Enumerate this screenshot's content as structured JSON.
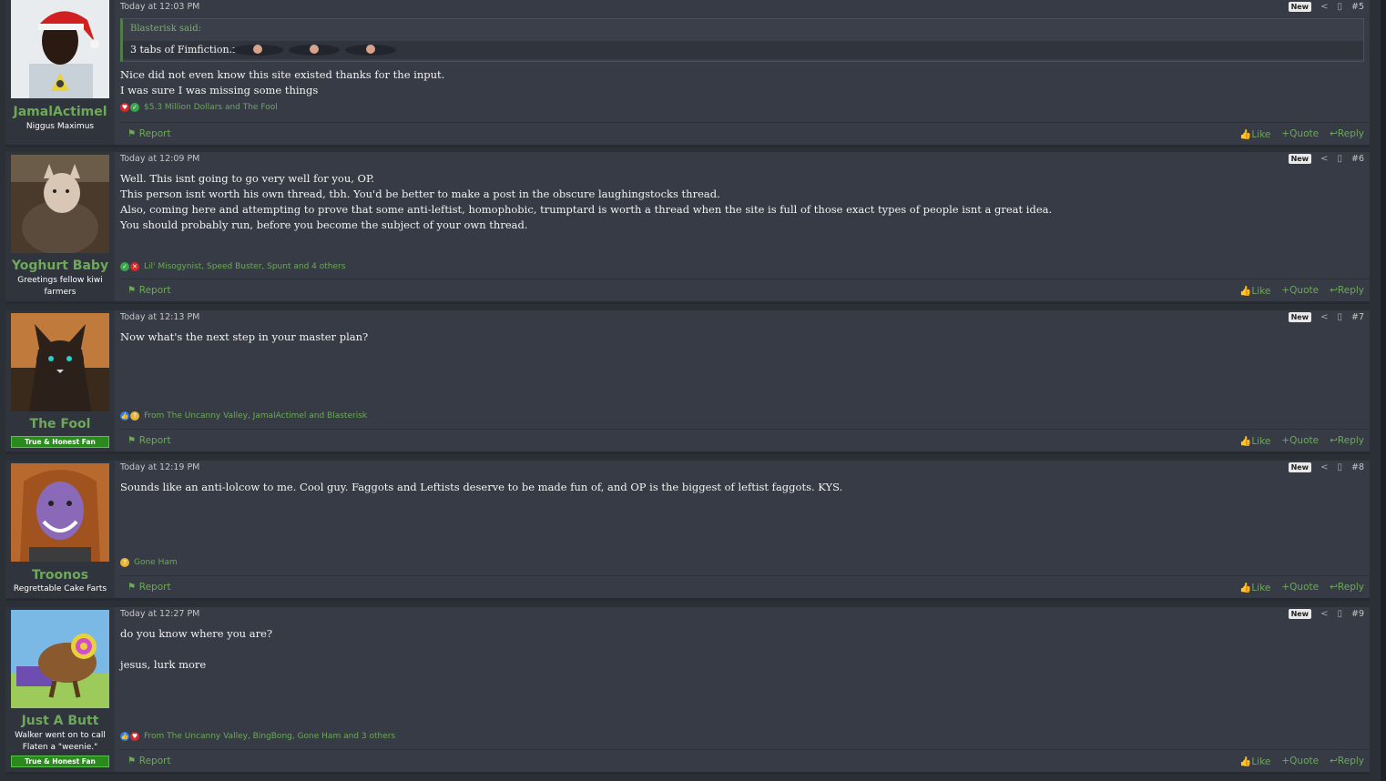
{
  "posts": [
    {
      "username": "JamalActimel",
      "user_title": "Niggus Maximus",
      "timestamp": "Today at 12:03 PM",
      "badge": "New",
      "post_number": "#5",
      "quote": {
        "author": "Blasterisk said:",
        "text": "3 tabs of Fimfiction.net"
      },
      "body": "Nice did not even know this site existed thanks for the input.\nI was sure I was missing some things",
      "reactions": "$5.3 Million Dollars and The Fool",
      "report": "Report",
      "like": "Like",
      "quote_label": "Quote",
      "reply": "Reply"
    },
    {
      "username": "Yoghurt Baby",
      "user_title": "Greetings fellow kiwi farmers",
      "timestamp": "Today at 12:09 PM",
      "badge": "New",
      "post_number": "#6",
      "body": "Well. This isnt going to go very well for you, OP.\nThis person isnt worth his own thread, tbh. You'd be better to make a post in the obscure laughingstocks thread.\nAlso, coming here and attempting to prove that some anti-leftist, homophobic, trumptard is worth a thread when the site is full of those exact types of people isnt a great idea.\nYou should probably run, before you become the subject of your own thread.",
      "reactions": "Lil' Misogynist, Speed Buster, Spunt and 4 others",
      "report": "Report",
      "like": "Like",
      "quote_label": "Quote",
      "reply": "Reply"
    },
    {
      "username": "The Fool",
      "banner": "True & Honest Fan",
      "timestamp": "Today at 12:13 PM",
      "badge": "New",
      "post_number": "#7",
      "body": "Now what's the next step in your master plan?",
      "reactions": "From The Uncanny Valley, JamalActimel and Blasterisk",
      "report": "Report",
      "like": "Like",
      "quote_label": "Quote",
      "reply": "Reply"
    },
    {
      "username": "Troonos",
      "user_title": "Regrettable Cake Farts",
      "timestamp": "Today at 12:19 PM",
      "badge": "New",
      "post_number": "#8",
      "body": "Sounds like an anti-lolcow to me. Cool guy. Faggots and Leftists deserve to be made fun of, and OP is the biggest of leftist faggots. KYS.",
      "reactions": "Gone Ham",
      "report": "Report",
      "like": "Like",
      "quote_label": "Quote",
      "reply": "Reply"
    },
    {
      "username": "Just A Butt",
      "user_title": "Walker went on to call Flaten a \"weenie.\"",
      "banner": "True & Honest Fan",
      "timestamp": "Today at 12:27 PM",
      "badge": "New",
      "post_number": "#9",
      "body": "do you know where you are?\n\njesus, lurk more",
      "reactions": "From The Uncanny Valley, BingBong, Gone Ham and 3 others",
      "report": "Report",
      "like": "Like",
      "quote_label": "Quote",
      "reply": "Reply"
    }
  ],
  "colors": {
    "accent": "#6ea85a",
    "background": "#2b2f36",
    "post_bg": "#363b45",
    "user_bg": "#30343d"
  },
  "icons": [
    "share-icon",
    "bookmark-icon",
    "like-icon",
    "quote-plus-icon",
    "reply-icon",
    "report-icon",
    "heart-reaction-icon",
    "check-reaction-icon",
    "thumbs-up-reaction-icon",
    "thinking-reaction-icon",
    "x-reaction-icon"
  ]
}
